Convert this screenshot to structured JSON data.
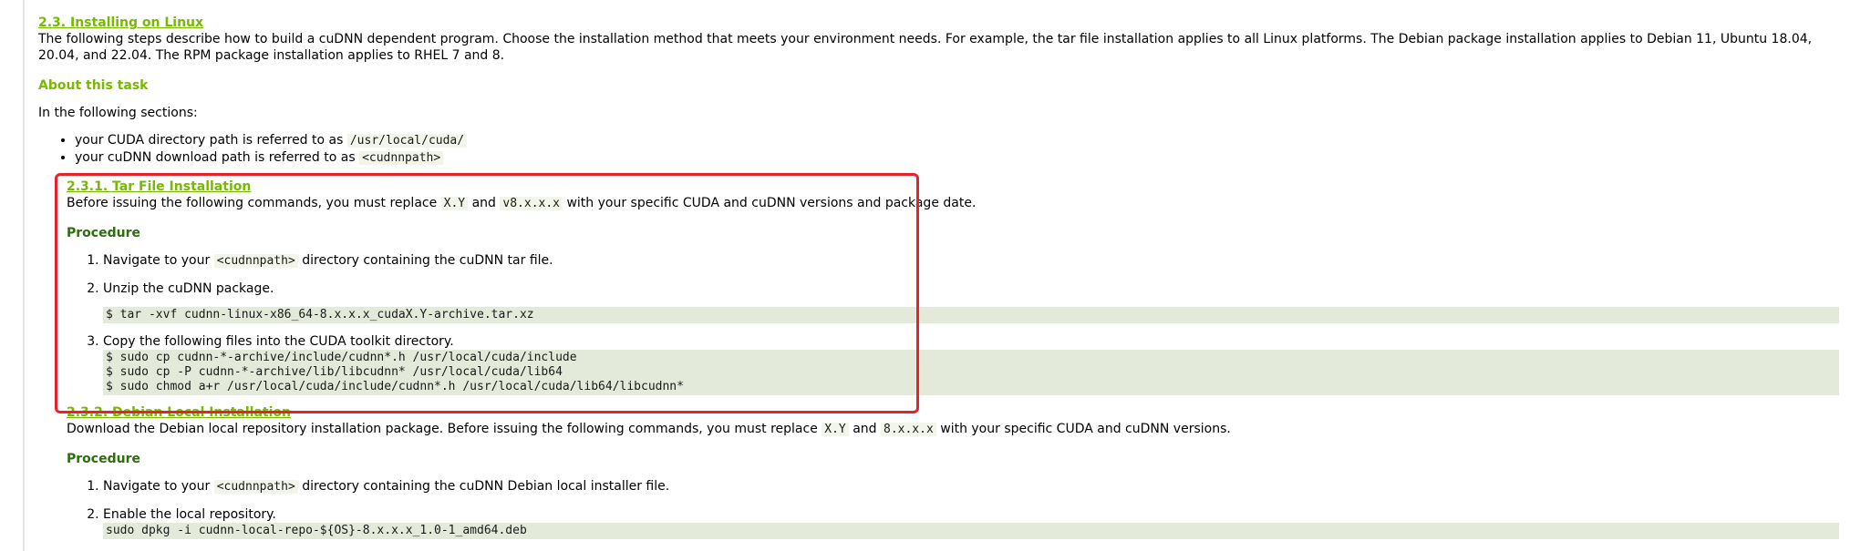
{
  "section": {
    "title": "2.3. Installing on Linux",
    "intro": "The following steps describe how to build a cuDNN dependent program. Choose the installation method that meets your environment needs. For example, the tar file installation applies to all Linux platforms. The Debian package installation applies to Debian 11, Ubuntu 18.04, 20.04, and 22.04. The RPM package installation applies to RHEL 7 and 8.",
    "about_title": "About this task",
    "following_text": "In the following sections:",
    "bullets": [
      {
        "prefix": "your CUDA directory path is referred to as ",
        "code": "/usr/local/cuda/"
      },
      {
        "prefix": "your cuDNN download path is referred to as ",
        "code": "<cudnnpath>"
      }
    ]
  },
  "tar": {
    "title": "2.3.1. Tar File Installation",
    "intro_a": "Before issuing the following commands, you must replace ",
    "code_a": "X.Y",
    "intro_b": " and ",
    "code_b": "v8.x.x.x",
    "intro_c": " with your specific CUDA and cuDNN versions and package date.",
    "procedure": "Procedure",
    "step1_a": "Navigate to your ",
    "step1_code": "<cudnnpath>",
    "step1_b": " directory containing the cuDNN tar file.",
    "step2": "Unzip the cuDNN package.",
    "step2_cmd": "$ tar -xvf cudnn-linux-x86_64-8.x.x.x_cudaX.Y-archive.tar.xz",
    "step3": "Copy the following files into the CUDA toolkit directory.",
    "step3_cmd": "$ sudo cp cudnn-*-archive/include/cudnn*.h /usr/local/cuda/include\n$ sudo cp -P cudnn-*-archive/lib/libcudnn* /usr/local/cuda/lib64\n$ sudo chmod a+r /usr/local/cuda/include/cudnn*.h /usr/local/cuda/lib64/libcudnn*"
  },
  "deb": {
    "title": "2.3.2. Debian Local Installation",
    "intro_a": "Download the Debian local repository installation package. Before issuing the following commands, you must replace ",
    "code_a": "X.Y",
    "intro_b": " and ",
    "code_b": "8.x.x.x",
    "intro_c": " with your specific CUDA and cuDNN versions.",
    "procedure": "Procedure",
    "step1_a": "Navigate to your ",
    "step1_code": "<cudnnpath>",
    "step1_b": " directory containing the cuDNN Debian local installer file.",
    "step2": "Enable the local repository.",
    "step2_cmd": "sudo dpkg -i cudnn-local-repo-${OS}-8.x.x.x_1.0-1_amd64.deb"
  },
  "colors": {
    "accent": "#76b900",
    "highlight": "#e8222d",
    "code_bg": "#e4eada"
  }
}
